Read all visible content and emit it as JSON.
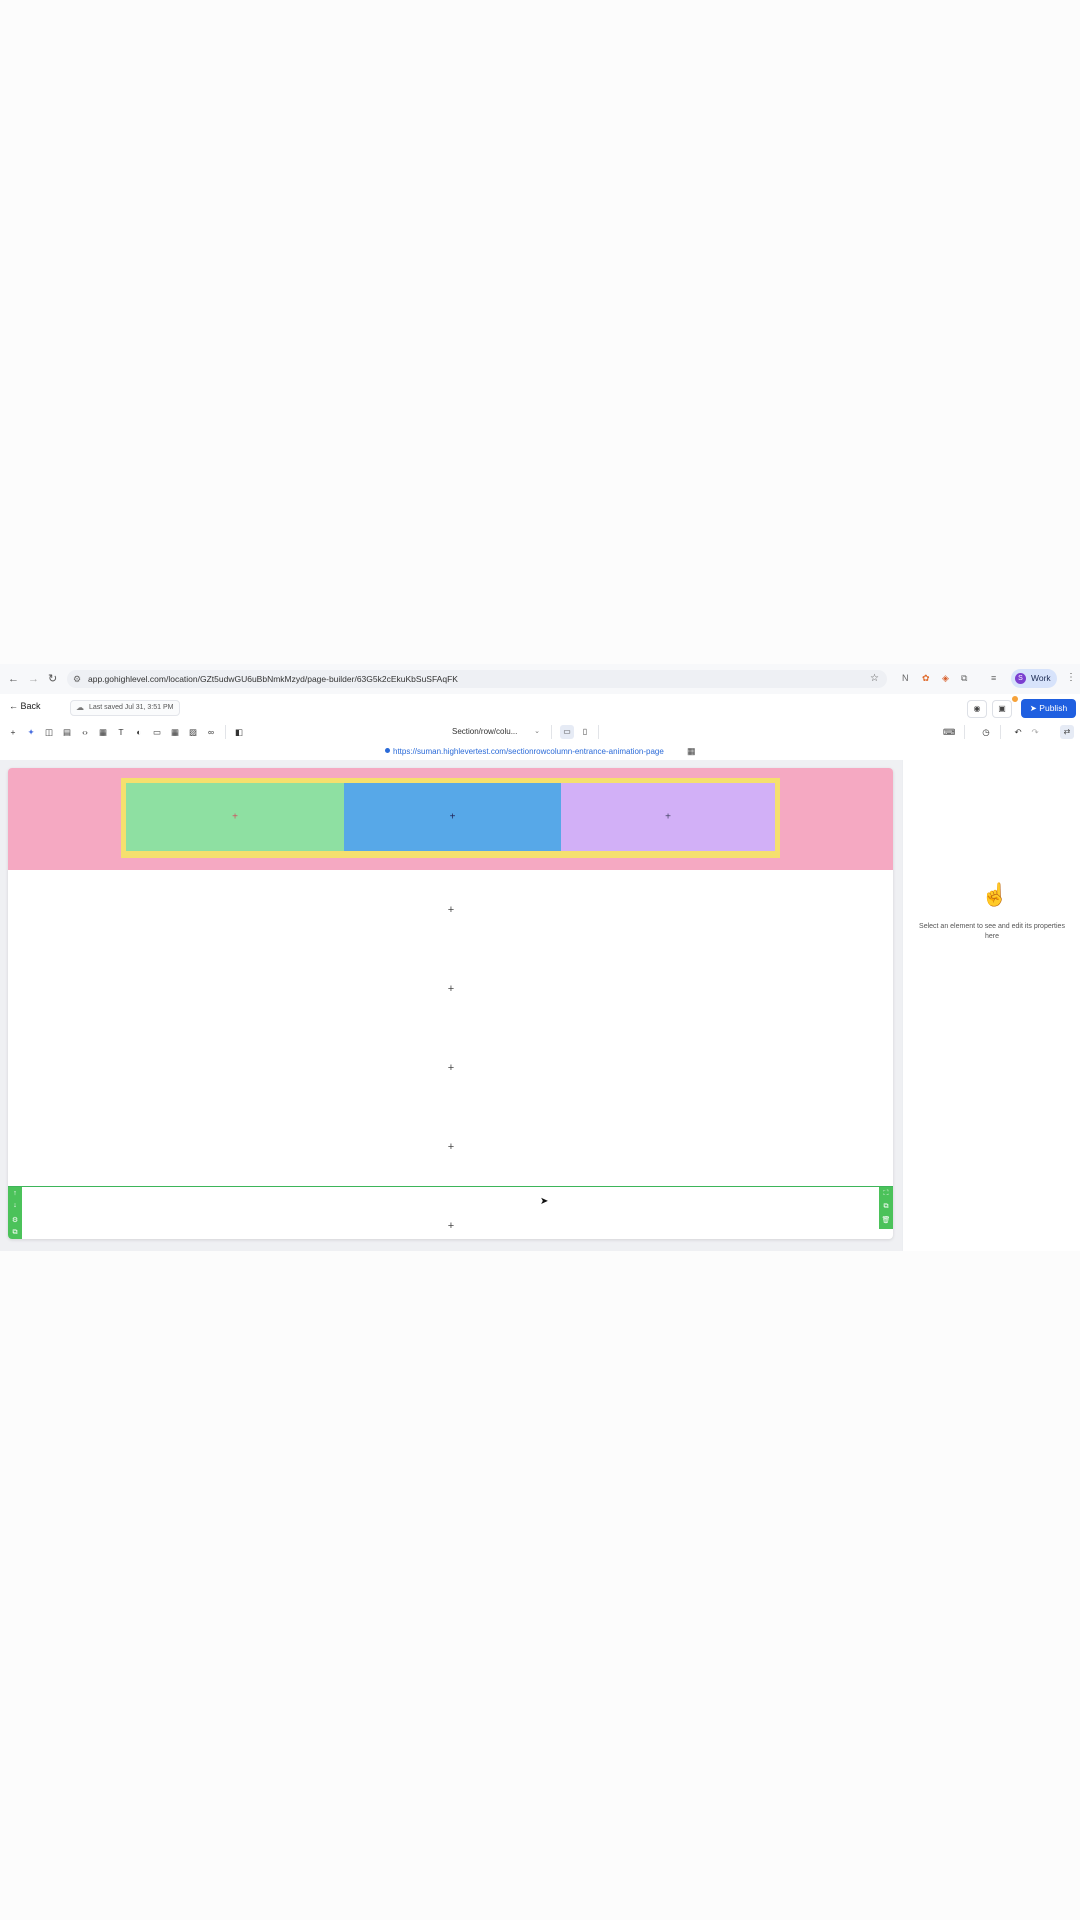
{
  "browser": {
    "url": "app.gohighlevel.com/location/GZt5udwGU6uBbNmkMzyd/page-builder/63G5k2cEkuKbSuSFAqFK",
    "profile_initial": "S",
    "profile_label": "Work"
  },
  "header": {
    "back_label": "Back",
    "last_saved": "Last saved Jul 31, 3:51 PM",
    "publish_label": "Publish"
  },
  "toolbar": {
    "page_select": "Section/row/colu..."
  },
  "preview_url": "https://suman.highlevertest.com/sectionrowcolumn-entrance-animation-page",
  "canvas": {
    "columns": [
      {
        "color": "#8ee0a2",
        "plus": "+"
      },
      {
        "color": "#57a8e8",
        "plus": "+"
      },
      {
        "color": "#d2b0f7",
        "plus": "+"
      }
    ],
    "add_placeholder": "+"
  },
  "right_panel": {
    "empty_message": "Select an element to see and edit its properties here"
  },
  "colors": {
    "section_bg": "#f5a9c2",
    "row_border": "#f5e06e",
    "selected_accent": "#4bc25a",
    "publish": "#1f5fe0"
  }
}
